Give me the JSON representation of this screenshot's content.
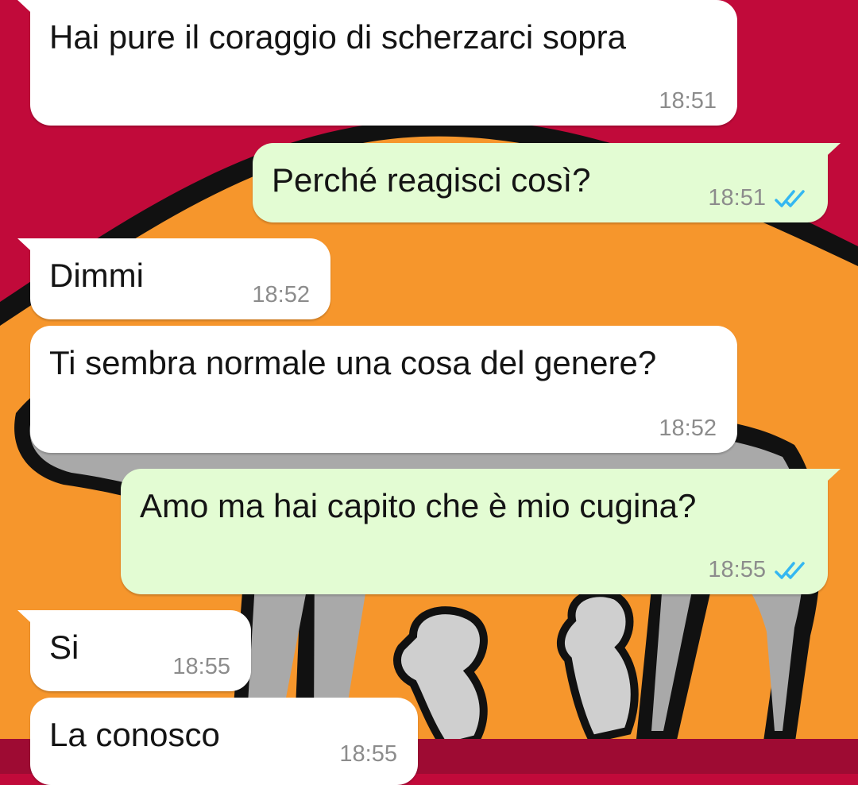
{
  "colors": {
    "wallpaper_red": "#c10a3a",
    "wallpaper_orange": "#f6962c",
    "incoming_bubble": "#ffffff",
    "outgoing_bubble": "#e3fcd3",
    "read_tick": "#34b7f1"
  },
  "messages": [
    {
      "direction": "incoming",
      "text": "Hai pure il coraggio di scherzarci sopra",
      "time": "18:51"
    },
    {
      "direction": "outgoing",
      "text": "Perché reagisci così?",
      "time": "18:51",
      "status_icon": "double-check-icon"
    },
    {
      "direction": "incoming",
      "text": "Dimmi",
      "time": "18:52"
    },
    {
      "direction": "incoming",
      "text": "Ti sembra normale una cosa del genere?",
      "time": "18:52"
    },
    {
      "direction": "outgoing",
      "text": "Amo ma hai capito che è mio cugina?",
      "time": "18:55",
      "status_icon": "double-check-icon"
    },
    {
      "direction": "incoming",
      "text": "Si",
      "time": "18:55"
    },
    {
      "direction": "incoming",
      "text": "La conosco",
      "time": "18:55"
    }
  ]
}
